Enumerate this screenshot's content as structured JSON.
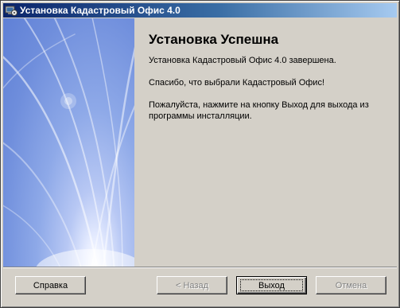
{
  "window": {
    "title": "Установка Кадастровый Офис 4.0",
    "icon": "installer-icon"
  },
  "content": {
    "heading": "Установка Успешна",
    "paragraphs": [
      "Установка Кадастровый Офис 4.0 завершена.",
      "Спасибо, что выбрали Кадастровый Офис!",
      "Пожалуйста, нажмите на кнопку Выход для выхода из программы инсталляции."
    ]
  },
  "buttons": {
    "help": "Справка",
    "back": "< Назад",
    "exit": "Выход",
    "cancel": "Отмена"
  },
  "colors": {
    "title_gradient_start": "#0a246a",
    "title_gradient_end": "#a6caf0",
    "side_panel": "#6f8edc",
    "dialog_face": "#d4d0c8"
  }
}
